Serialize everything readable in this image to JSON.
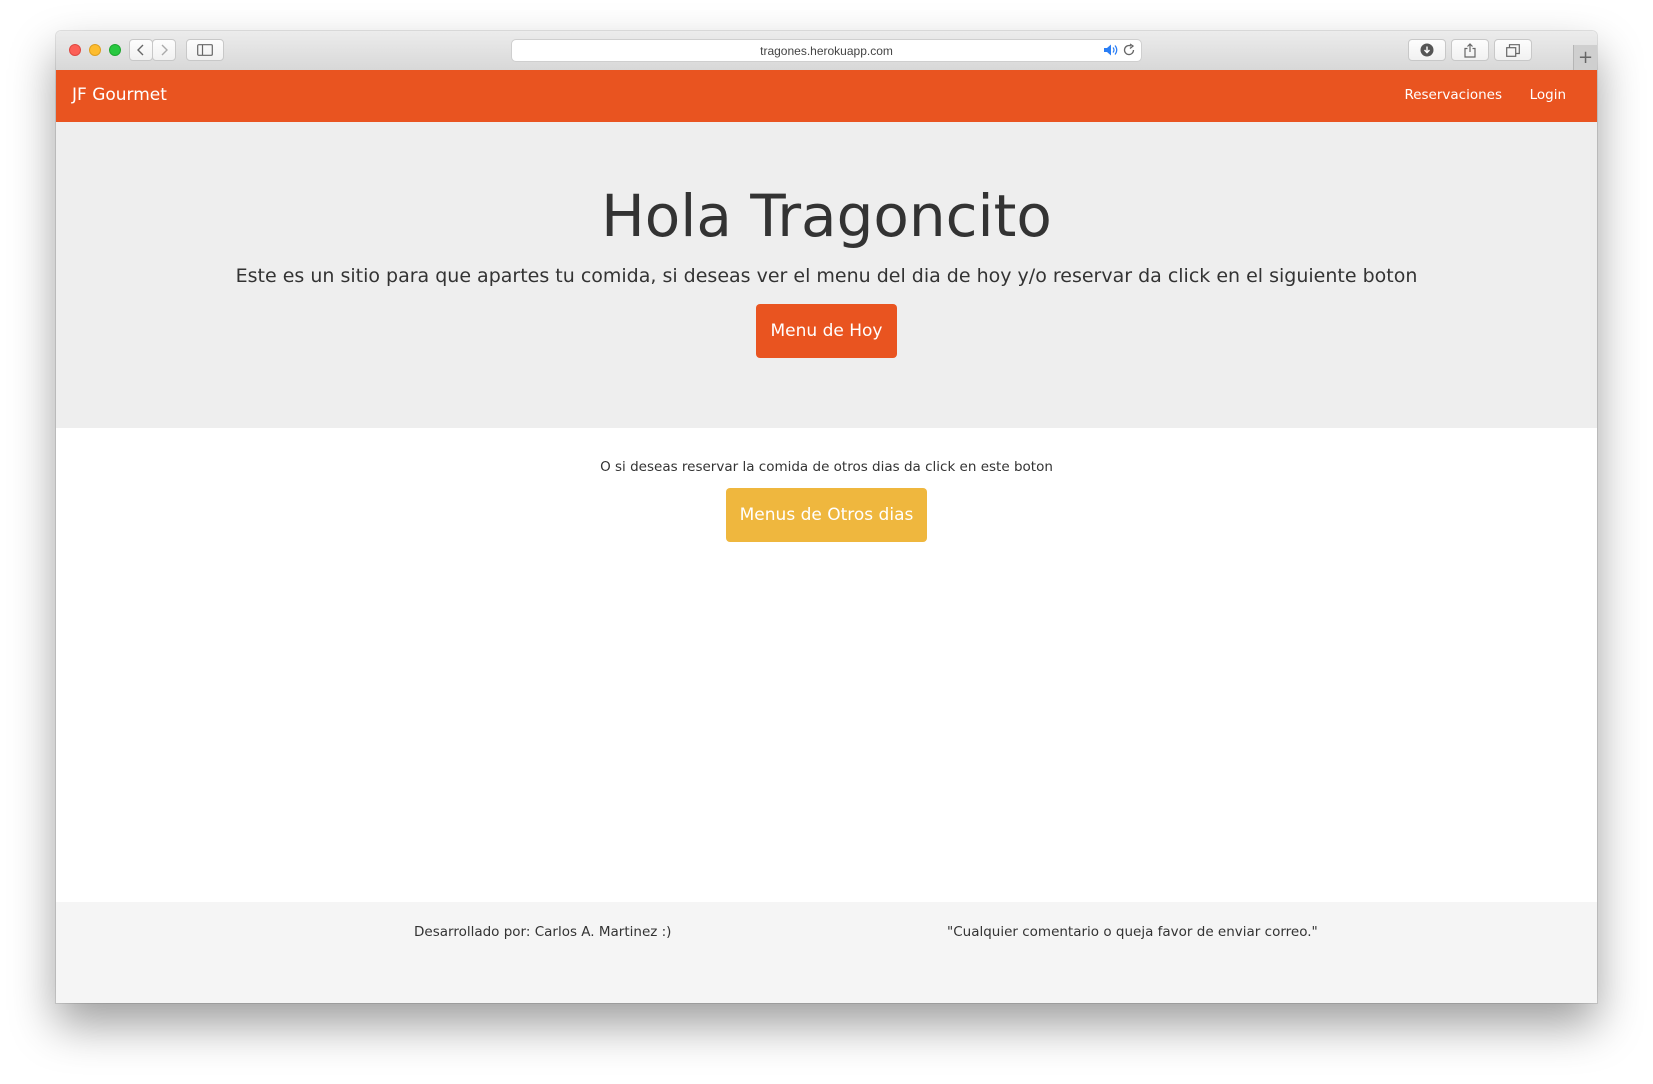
{
  "browser": {
    "url": "tragones.herokuapp.com",
    "new_tab_label": "+"
  },
  "navbar": {
    "brand": "JF Gourmet",
    "links": [
      {
        "label": "Reservaciones"
      },
      {
        "label": "Login"
      }
    ],
    "color": "#e95420"
  },
  "hero": {
    "title": "Hola Tragoncito",
    "text": "Este es un sitio para que apartes tu comida, si deseas ver el menu del dia de hoy y/o reservar da click en el siguiente boton",
    "button_label": "Menu de Hoy"
  },
  "content": {
    "text": "O si deseas reservar la comida de otros dias da click en este boton",
    "button_label": "Menus de Otros dias",
    "button_color": "#efb73e"
  },
  "footer": {
    "left": "Desarrollado por: Carlos A. Martinez :)",
    "right": "\"Cualquier comentario o queja favor de enviar correo.\""
  }
}
